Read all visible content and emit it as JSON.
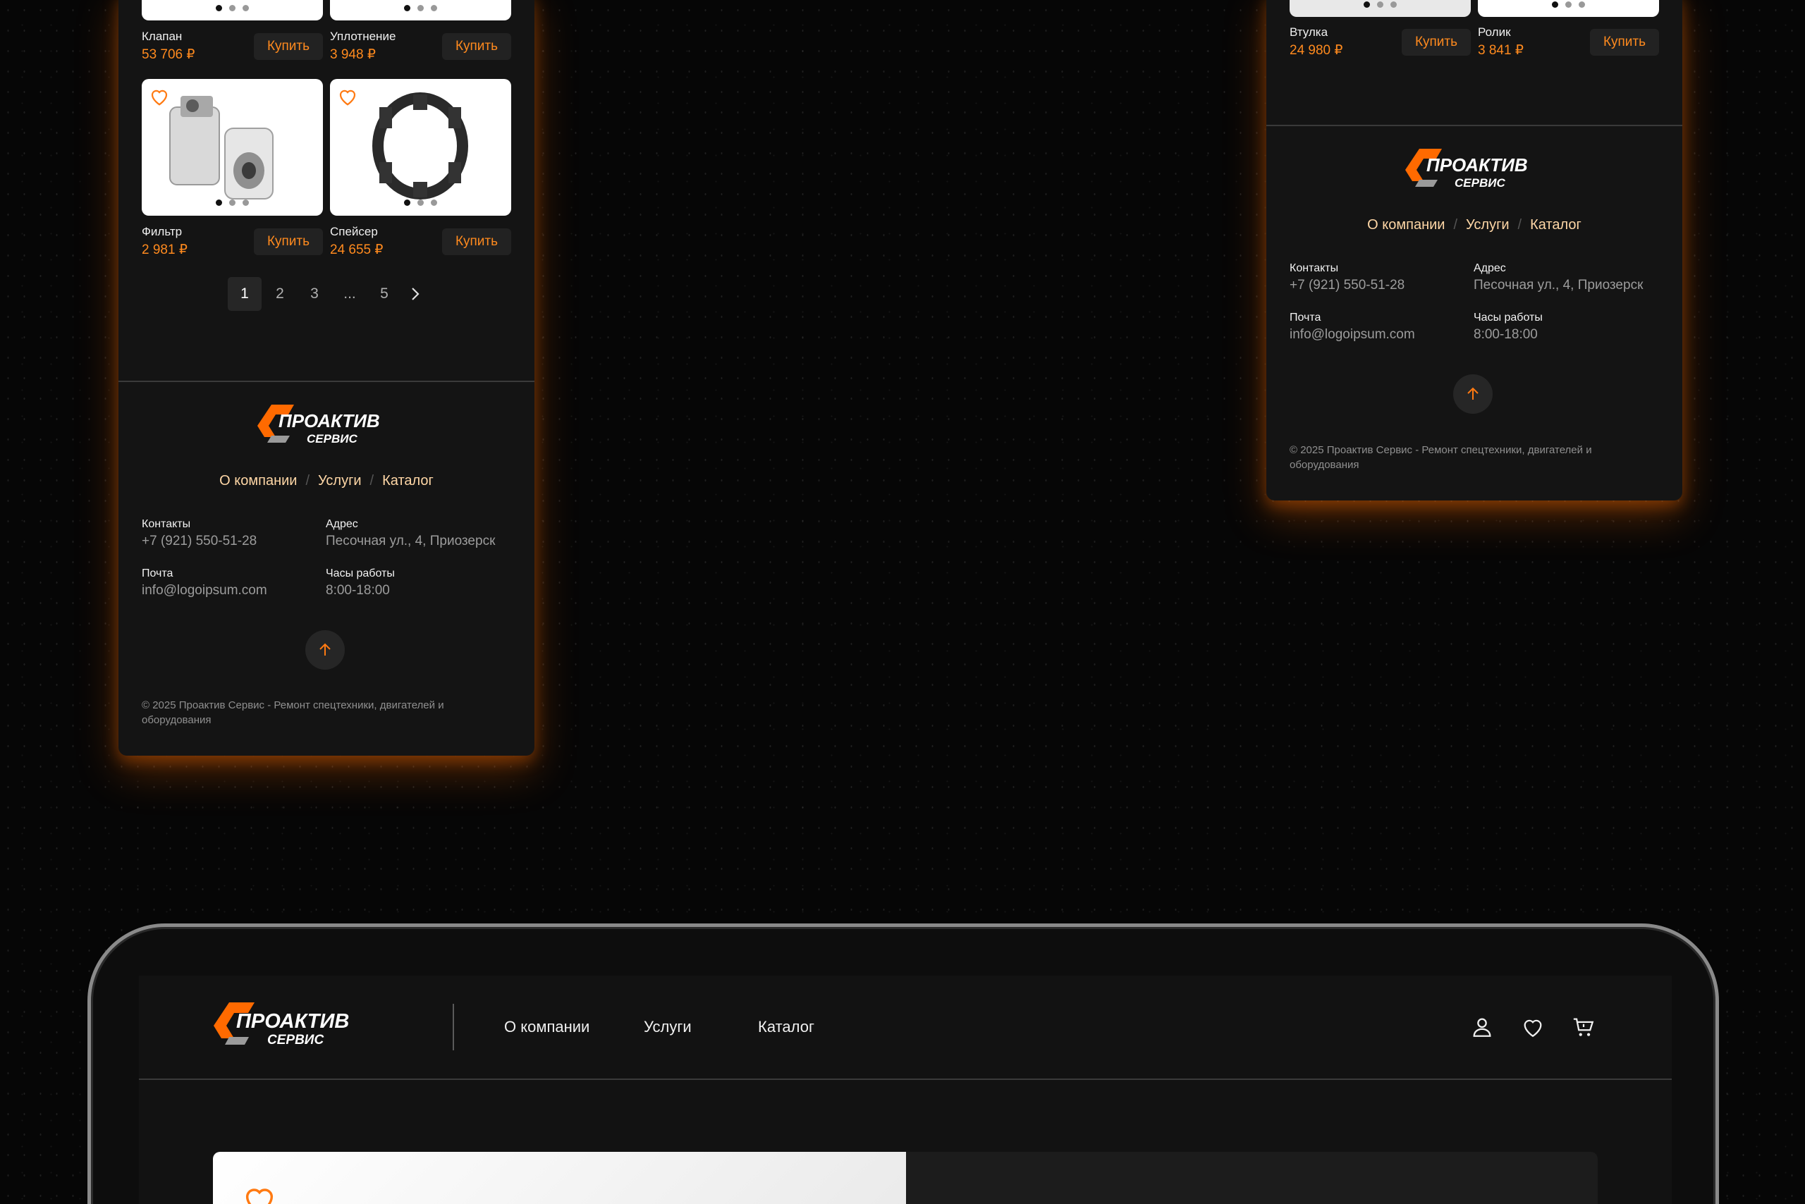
{
  "brand": {
    "line1": "ПРОАКТИВ",
    "line2": "СЕРВИС",
    "accent": "#ff6a00"
  },
  "colors": {
    "accent": "#ff8a1e",
    "link": "#ffd7a6",
    "background": "#060606",
    "panel": "#141414"
  },
  "left_phone": {
    "products": [
      {
        "name": "Клапан",
        "price": "53 706 ₽",
        "buy": "Купить"
      },
      {
        "name": "Уплотнение",
        "price": "3 948 ₽",
        "buy": "Купить"
      },
      {
        "name": "Фильтр",
        "price": "2 981 ₽",
        "buy": "Купить",
        "image": "filter-icon"
      },
      {
        "name": "Спейсер",
        "price": "24 655 ₽",
        "buy": "Купить",
        "image": "spacer-ring-icon"
      }
    ],
    "pagination": {
      "pages": [
        "1",
        "2",
        "3",
        "...",
        "5"
      ],
      "current": "1"
    }
  },
  "right_phone": {
    "products": [
      {
        "name": "Втулка",
        "price": "24 980 ₽",
        "buy": "Купить"
      },
      {
        "name": "Ролик",
        "price": "3 841 ₽",
        "buy": "Купить"
      }
    ]
  },
  "footer": {
    "nav": [
      "О компании",
      "Услуги",
      "Каталог"
    ],
    "separator": "/",
    "contacts_label": "Контакты",
    "contacts_value": "+7 (921) 550-51-28",
    "address_label": "Адрес",
    "address_value": "Песочная ул., 4, Приозерск",
    "mail_label": "Почта",
    "mail_value": "info@logoipsum.com",
    "hours_label": "Часы работы",
    "hours_value": "8:00-18:00",
    "copyright_line1": "© 2025 Проактив Сервис - Ремонт спецтехники, двигателей и",
    "copyright_line2": "оборудования"
  },
  "laptop": {
    "nav": [
      "О компании",
      "Услуги",
      "Каталог"
    ],
    "icons": [
      "user-icon",
      "heart-icon",
      "cart-icon"
    ]
  }
}
